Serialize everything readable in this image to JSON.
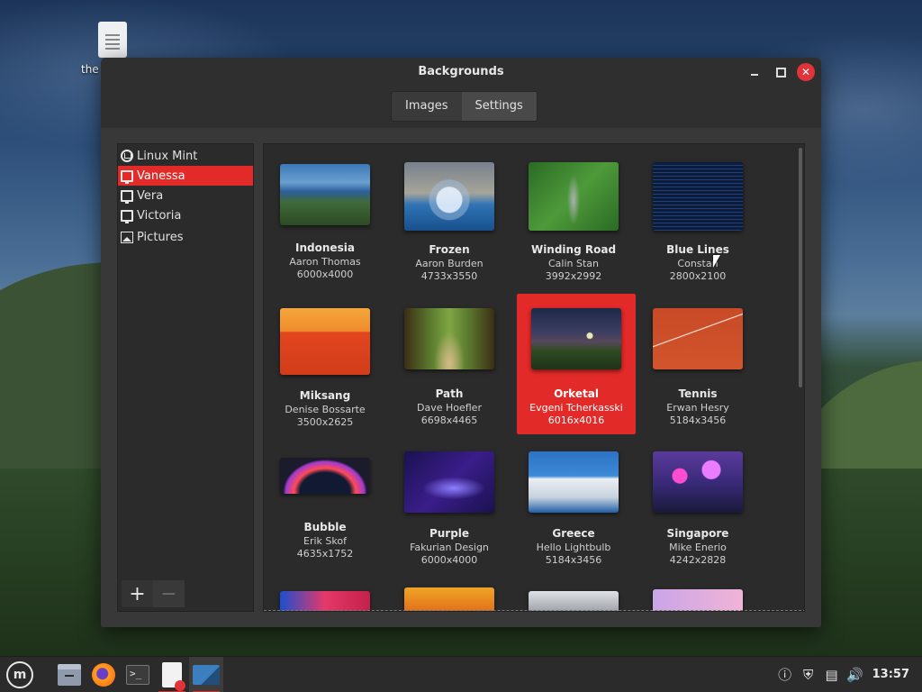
{
  "desktop": {
    "icon_label": "the p"
  },
  "window": {
    "title": "Backgrounds",
    "tabs": [
      {
        "label": "Images",
        "active": false
      },
      {
        "label": "Settings",
        "active": true
      }
    ]
  },
  "sidebar": {
    "items": [
      {
        "label": "Linux Mint",
        "icon": "linux-mint-logo-icon"
      },
      {
        "label": "Vanessa",
        "icon": "monitor-icon",
        "selected": true
      },
      {
        "label": "Vera",
        "icon": "monitor-icon"
      },
      {
        "label": "Victoria",
        "icon": "monitor-icon"
      },
      {
        "label": "Pictures",
        "icon": "pictures-folder-icon"
      }
    ],
    "add_label": "+",
    "remove_label": "−"
  },
  "backgrounds": [
    {
      "name": "Indonesia",
      "author": "Aaron Thomas",
      "dims": "6000x4000"
    },
    {
      "name": "Frozen",
      "author": "Aaron Burden",
      "dims": "4733x3550"
    },
    {
      "name": "Winding Road",
      "author": "Calin Stan",
      "dims": "3992x2992"
    },
    {
      "name": "Blue Lines",
      "author": "Constan",
      "dims": "2800x2100"
    },
    {
      "name": "Miksang",
      "author": "Denise Bossarte",
      "dims": "3500x2625"
    },
    {
      "name": "Path",
      "author": "Dave Hoefler",
      "dims": "6698x4465"
    },
    {
      "name": "Orketal",
      "author": "Evgeni Tcherkasski",
      "dims": "6016x4016",
      "selected": true
    },
    {
      "name": "Tennis",
      "author": "Erwan Hesry",
      "dims": "5184x3456"
    },
    {
      "name": "Bubble",
      "author": "Erik Skof",
      "dims": "4635x1752"
    },
    {
      "name": "Purple",
      "author": "Fakurian Design",
      "dims": "6000x4000"
    },
    {
      "name": "Greece",
      "author": "Hello Lightbulb",
      "dims": "5184x3456"
    },
    {
      "name": "Singapore",
      "author": "Mike Enerio",
      "dims": "4242x2828"
    }
  ],
  "panel": {
    "apps": [
      "menu-icon",
      "files-icon",
      "firefox-icon",
      "terminal-icon",
      "text-editor-icon",
      "backgrounds-icon"
    ],
    "tray": [
      "update-manager-icon",
      "shield-icon",
      "network-icon",
      "volume-icon"
    ],
    "clock": "13:57"
  },
  "colors": {
    "accent": "#e22a29",
    "window_bg": "#383838",
    "panel_bg": "#2b2b2b"
  }
}
